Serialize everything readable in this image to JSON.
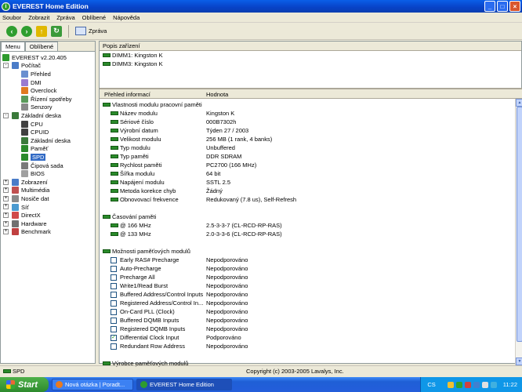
{
  "window": {
    "title": "EVEREST Home Edition"
  },
  "menu": [
    "Soubor",
    "Zobrazit",
    "Zpráva",
    "Oblíbené",
    "Nápověda"
  ],
  "toolbar": {
    "report_label": "Zpráva"
  },
  "left": {
    "tabs": [
      "Menu",
      "Oblíbené"
    ],
    "tree": [
      {
        "label": "EVEREST v2.20.405",
        "level": 0,
        "icon": "everest-icon",
        "color": "#2e9b2e"
      },
      {
        "label": "Počítač",
        "level": 1,
        "icon": "computer-icon",
        "color": "#4a7cc8",
        "expander": "-"
      },
      {
        "label": "Přehled",
        "level": 2,
        "icon": "overview-icon",
        "color": "#6a8fd0"
      },
      {
        "label": "DMI",
        "level": 2,
        "icon": "dmi-icon",
        "color": "#9a7ad0"
      },
      {
        "label": "Overclock",
        "level": 2,
        "icon": "overclock-icon",
        "color": "#e07a20"
      },
      {
        "label": "Řízení spotřeby",
        "level": 2,
        "icon": "power-icon",
        "color": "#5a9a5a"
      },
      {
        "label": "Senzory",
        "level": 2,
        "icon": "sensor-icon",
        "color": "#8a8a8a"
      },
      {
        "label": "Základní deska",
        "level": 1,
        "icon": "motherboard-icon",
        "color": "#3a7a3a",
        "expander": "-"
      },
      {
        "label": "CPU",
        "level": 2,
        "icon": "cpu-icon",
        "color": "#404040"
      },
      {
        "label": "CPUID",
        "level": 2,
        "icon": "cpuid-icon",
        "color": "#404040"
      },
      {
        "label": "Základní deska",
        "level": 2,
        "icon": "board-icon",
        "color": "#3a7a3a"
      },
      {
        "label": "Paměť",
        "level": 2,
        "icon": "memory-icon",
        "color": "#2a8a2a"
      },
      {
        "label": "SPD",
        "level": 2,
        "icon": "spd-icon",
        "color": "#2a8a2a",
        "selected": true
      },
      {
        "label": "Čipová sada",
        "level": 2,
        "icon": "chipset-icon",
        "color": "#7a7a7a"
      },
      {
        "label": "BIOS",
        "level": 2,
        "icon": "bios-icon",
        "color": "#a0a0a0"
      },
      {
        "label": "Zobrazení",
        "level": 1,
        "icon": "display-icon",
        "color": "#4a7cc8",
        "expander": "+"
      },
      {
        "label": "Multimédia",
        "level": 1,
        "icon": "multimedia-icon",
        "color": "#c05050",
        "expander": "+"
      },
      {
        "label": "Nosiče dat",
        "level": 1,
        "icon": "storage-icon",
        "color": "#8a8a8a",
        "expander": "+"
      },
      {
        "label": "Síť",
        "level": 1,
        "icon": "network-icon",
        "color": "#4a9ad0",
        "expander": "+"
      },
      {
        "label": "DirectX",
        "level": 1,
        "icon": "directx-icon",
        "color": "#d04a4a",
        "expander": "+"
      },
      {
        "label": "Hardware",
        "level": 1,
        "icon": "hardware-icon",
        "color": "#707070",
        "expander": "+"
      },
      {
        "label": "Benchmark",
        "level": 1,
        "icon": "benchmark-icon",
        "color": "#c04040",
        "expander": "+"
      }
    ]
  },
  "devices": {
    "header": "Popis zařízení",
    "items": [
      "DIMM1: Kingston K",
      "DIMM3: Kingston K"
    ]
  },
  "details": {
    "col_field": "Přehled informací",
    "col_value": "Hodnota",
    "sections": [
      {
        "title": "Vlastnosti modulu pracovní paměti",
        "rows": [
          {
            "field": "Název modulu",
            "value": "Kingston K"
          },
          {
            "field": "Sériové číslo",
            "value": "000B7302h"
          },
          {
            "field": "Výrobní datum",
            "value": "Týden 27 / 2003"
          },
          {
            "field": "Velikost modulu",
            "value": "256 MB  (1 rank, 4 banks)"
          },
          {
            "field": "Typ modulu",
            "value": "Unbuffered"
          },
          {
            "field": "Typ paměti",
            "value": "DDR SDRAM"
          },
          {
            "field": "Rychlost paměti",
            "value": "PC2700 (166 MHz)"
          },
          {
            "field": "Šířka modulu",
            "value": "64 bit"
          },
          {
            "field": "Napájení modulu",
            "value": "SSTL 2.5"
          },
          {
            "field": "Metoda korekce chyb",
            "value": "Žádný"
          },
          {
            "field": "Obnovovací frekvence",
            "value": "Redukovaný (7.8 us), Self-Refresh"
          }
        ]
      },
      {
        "title": "Časování paměti",
        "rows": [
          {
            "field": "@ 166 MHz",
            "value": "2.5-3-3-7  (CL-RCD-RP-RAS)"
          },
          {
            "field": "@ 133 MHz",
            "value": "2.0-3-3-6  (CL-RCD-RP-RAS)"
          }
        ]
      },
      {
        "title": "Možnosti paměťových modulů",
        "rows": [
          {
            "field": "Early RAS# Precharge",
            "value": "Nepodporováno",
            "checked": false
          },
          {
            "field": "Auto-Precharge",
            "value": "Nepodporováno",
            "checked": false
          },
          {
            "field": "Precharge All",
            "value": "Nepodporováno",
            "checked": false
          },
          {
            "field": "Write1/Read Burst",
            "value": "Nepodporováno",
            "checked": false
          },
          {
            "field": "Buffered Address/Control Inputs",
            "value": "Nepodporováno",
            "checked": false
          },
          {
            "field": "Registered Address/Control In...",
            "value": "Nepodporováno",
            "checked": false
          },
          {
            "field": "On-Card PLL (Clock)",
            "value": "Nepodporováno",
            "checked": false
          },
          {
            "field": "Buffered DQMB Inputs",
            "value": "Nepodporováno",
            "checked": false
          },
          {
            "field": "Registered DQMB Inputs",
            "value": "Nepodporováno",
            "checked": false
          },
          {
            "field": "Differential Clock Input",
            "value": "Podporováno",
            "checked": true
          },
          {
            "field": "Redundant Row Address",
            "value": "Nepodporováno",
            "checked": false
          }
        ]
      },
      {
        "title": "Výrobce paměťových modulů",
        "rows": []
      }
    ]
  },
  "status": {
    "left": "SPD",
    "center": "Copyright (c) 2003-2005 Lavalys, Inc."
  },
  "taskbar": {
    "start": "Start",
    "tasks": [
      "Nová otázka | Poradt...",
      "EVEREST Home Edition"
    ],
    "lang": "CS",
    "clock": "11:22"
  }
}
